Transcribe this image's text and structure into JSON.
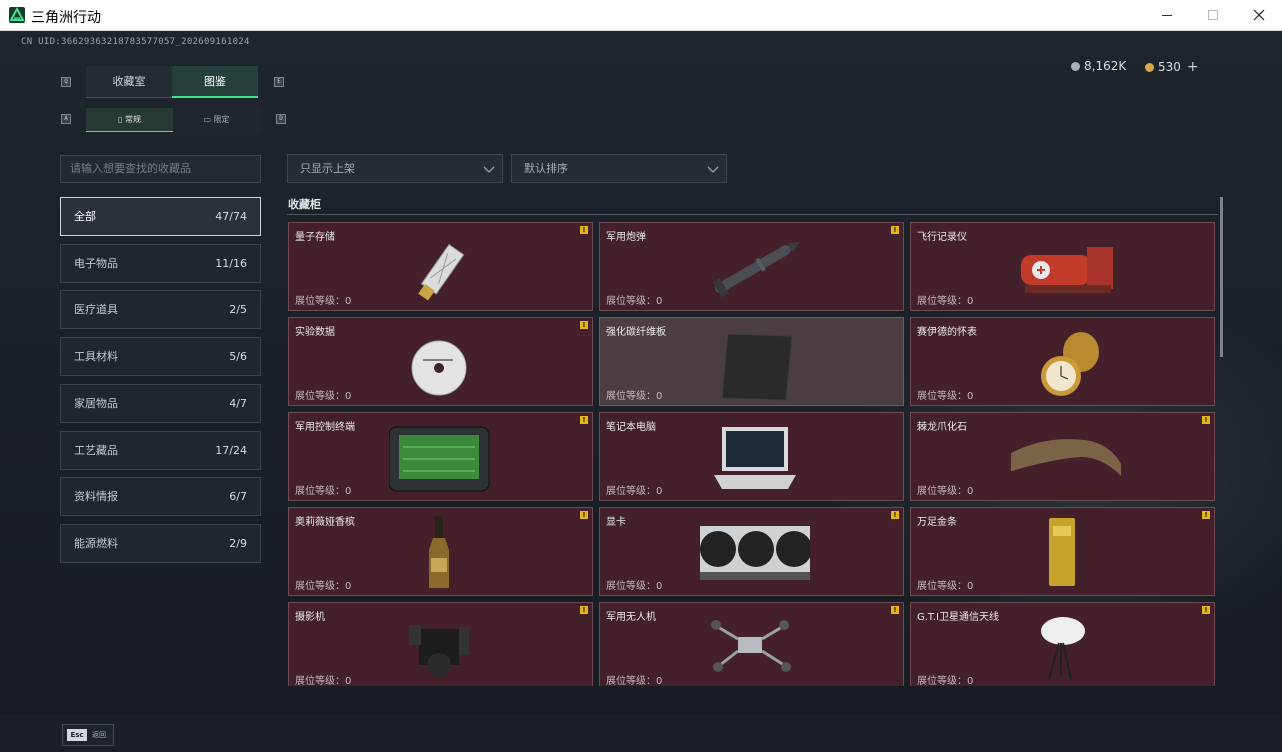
{
  "window": {
    "title": "三角洲行动"
  },
  "header": {
    "uid": "CN UID:36629363218783577057_202609161024"
  },
  "currency": [
    {
      "value": "8,162K",
      "color": "#a9b1b8"
    },
    {
      "value": "530",
      "color": "#d8a94a",
      "plus": "+"
    }
  ],
  "tabs": [
    {
      "label": "收藏室",
      "active": false
    },
    {
      "label": "图鉴",
      "active": true
    }
  ],
  "tab_keys": {
    "left": "Q",
    "right": "E"
  },
  "subtabs": [
    {
      "label": "常规",
      "active": true,
      "icon": "bottle-icon"
    },
    {
      "label": "限定",
      "active": false,
      "icon": "card-icon"
    }
  ],
  "subtab_keys": {
    "left": "A",
    "right": "D"
  },
  "search": {
    "placeholder": "请输入想要查找的收藏品"
  },
  "filters": [
    {
      "label": "只显示上架"
    },
    {
      "label": "默认排序"
    }
  ],
  "categories": [
    {
      "label": "全部",
      "count": "47/74",
      "active": true
    },
    {
      "label": "电子物品",
      "count": "11/16"
    },
    {
      "label": "医疗道具",
      "count": "2/5"
    },
    {
      "label": "工具材料",
      "count": "5/6"
    },
    {
      "label": "家居物品",
      "count": "4/7"
    },
    {
      "label": "工艺藏品",
      "count": "17/24"
    },
    {
      "label": "资料情报",
      "count": "6/7"
    },
    {
      "label": "能源燃料",
      "count": "2/9"
    }
  ],
  "section": {
    "title": "收藏柜"
  },
  "items": [
    {
      "name": "量子存储",
      "level": "展位等级：0",
      "flag": true,
      "icon": "usb-drive-icon"
    },
    {
      "name": "军用炮弹",
      "level": "展位等级：0",
      "flag": true,
      "icon": "missile-icon"
    },
    {
      "name": "飞行记录仪",
      "level": "展位等级：0",
      "flag": false,
      "icon": "flight-recorder-icon"
    },
    {
      "name": "实验数据",
      "level": "展位等级：0",
      "flag": true,
      "icon": "disc-icon"
    },
    {
      "name": "强化碳纤维板",
      "level": "展位等级：0",
      "flag": false,
      "icon": "carbon-plate-icon",
      "gray": true
    },
    {
      "name": "赛伊德的怀表",
      "level": "展位等级：0",
      "flag": false,
      "icon": "pocket-watch-icon"
    },
    {
      "name": "军用控制终端",
      "level": "展位等级：0",
      "flag": true,
      "icon": "control-terminal-icon"
    },
    {
      "name": "笔记本电脑",
      "level": "展位等级：0",
      "flag": false,
      "icon": "laptop-icon"
    },
    {
      "name": "棘龙爪化石",
      "level": "展位等级：0",
      "flag": true,
      "icon": "claw-fossil-icon"
    },
    {
      "name": "奥莉薇娅香槟",
      "level": "展位等级：0",
      "flag": true,
      "icon": "champagne-icon"
    },
    {
      "name": "显卡",
      "level": "展位等级：0",
      "flag": true,
      "icon": "graphics-card-icon"
    },
    {
      "name": "万足金条",
      "level": "展位等级：0",
      "flag": true,
      "icon": "gold-bar-icon"
    },
    {
      "name": "摄影机",
      "level": "展位等级：0",
      "flag": true,
      "icon": "camera-icon"
    },
    {
      "name": "军用无人机",
      "level": "展位等级：0",
      "flag": true,
      "icon": "drone-icon"
    },
    {
      "name": "G.T.I卫星通信天线",
      "level": "展位等级：0",
      "flag": true,
      "icon": "satellite-dish-icon"
    }
  ],
  "footer": {
    "esc_key": "Esc",
    "esc_label": "返回"
  }
}
